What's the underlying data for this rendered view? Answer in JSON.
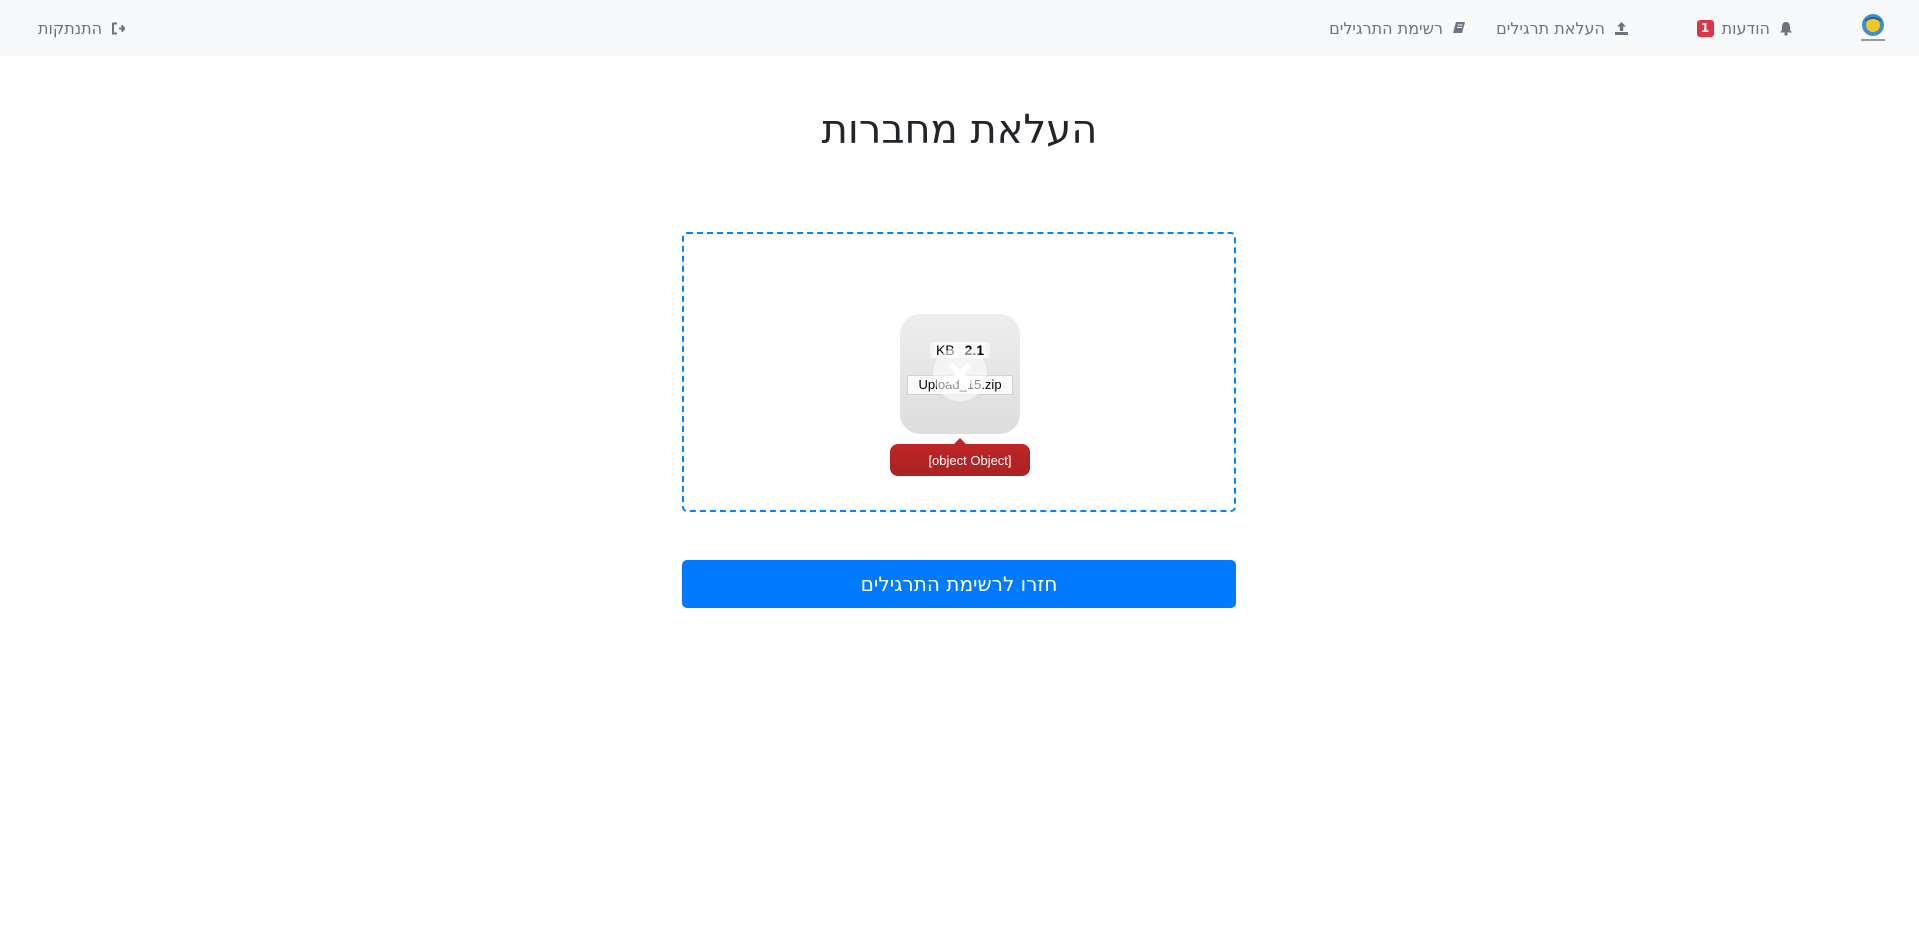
{
  "navbar": {
    "logo_icon": "organization-logo-icon",
    "notifications": {
      "label": "הודעות",
      "badge_count": "1",
      "icon": "bell-icon"
    },
    "upload_exercises": {
      "label": "העלאת תרגילים",
      "icon": "upload-icon"
    },
    "exercise_list": {
      "label": "רשימת התרגילים",
      "icon": "book-icon"
    },
    "logout": {
      "label": "התנתקות",
      "icon": "sign-out-icon"
    }
  },
  "page": {
    "title": "העלאת מחברות"
  },
  "dropzone": {
    "border_color": "#0087f7",
    "file": {
      "size_value": "KB",
      "size_number": "2.1",
      "filename": "Upload_15.zip",
      "error_message": "[object Object]"
    }
  },
  "back_button": {
    "label": "חזרו לרשימת התרגילים",
    "color": "#007bff"
  }
}
